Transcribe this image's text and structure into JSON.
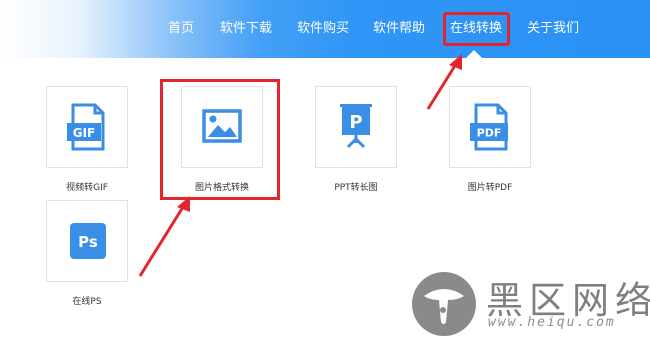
{
  "nav": {
    "items": [
      {
        "label": "首页"
      },
      {
        "label": "软件下载"
      },
      {
        "label": "软件购买"
      },
      {
        "label": "软件帮助"
      },
      {
        "label": "在线转换",
        "active": true
      },
      {
        "label": "关于我们"
      }
    ]
  },
  "tools": [
    {
      "label": "视频转GIF",
      "icon": "gif-file-icon",
      "badge": "GIF"
    },
    {
      "label": "图片格式转换",
      "icon": "image-icon",
      "highlighted": true
    },
    {
      "label": "PPT转长图",
      "icon": "presentation-board-icon",
      "badge": "P"
    },
    {
      "label": "图片转PDF",
      "icon": "pdf-file-icon",
      "badge": "PDF"
    },
    {
      "label": "在线PS",
      "icon": "photoshop-icon",
      "badge": "Ps"
    }
  ],
  "watermark": {
    "text": "黑区网络",
    "url": "www.heiqu.com"
  },
  "colors": {
    "accent_blue": "#2f95f6",
    "icon_blue": "#3a8ee6",
    "highlight_red": "#e3262e"
  }
}
